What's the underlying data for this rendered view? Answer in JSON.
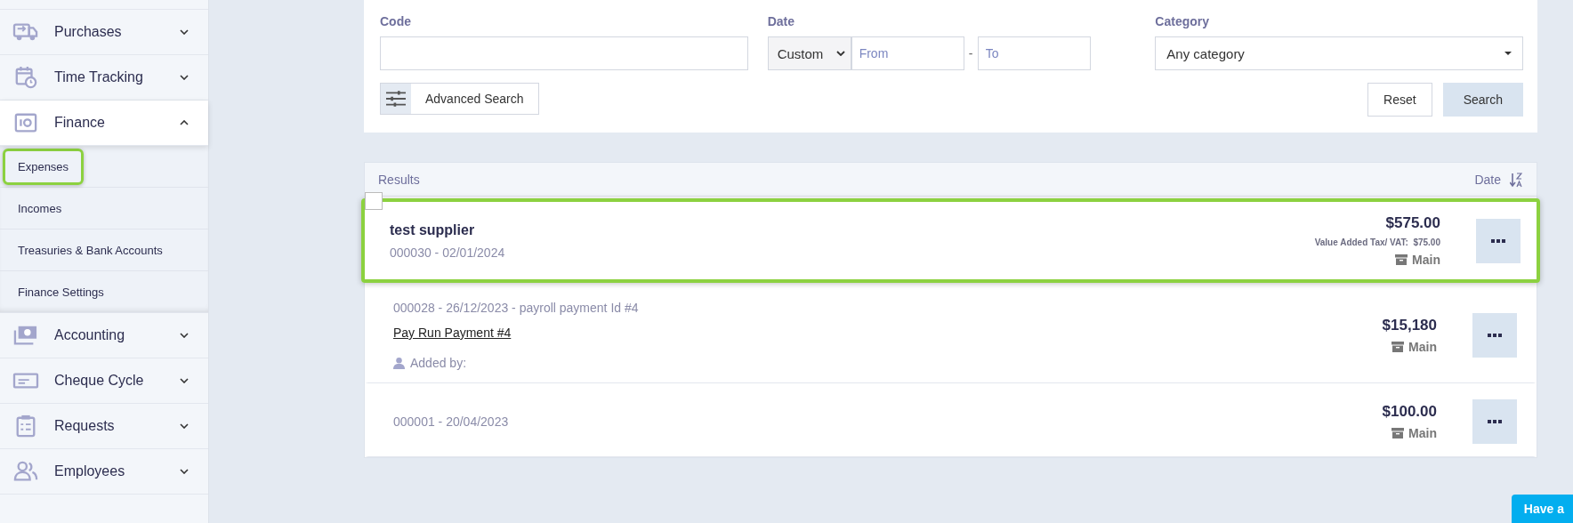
{
  "sidebar": {
    "items": [
      {
        "label": "Purchases",
        "expanded": false
      },
      {
        "label": "Time Tracking",
        "expanded": false
      },
      {
        "label": "Finance",
        "expanded": true,
        "children": [
          {
            "label": "Expenses",
            "highlighted": true
          },
          {
            "label": "Incomes",
            "highlighted": false
          },
          {
            "label": "Treasuries & Bank Accounts",
            "highlighted": false
          },
          {
            "label": "Finance Settings",
            "highlighted": false
          }
        ]
      },
      {
        "label": "Accounting",
        "expanded": false
      },
      {
        "label": "Cheque Cycle",
        "expanded": false
      },
      {
        "label": "Requests",
        "expanded": false
      },
      {
        "label": "Employees",
        "expanded": false
      }
    ]
  },
  "search": {
    "code_label": "Code",
    "date_label": "Date",
    "date_mode": "Custom",
    "from_placeholder": "From",
    "separator": "-",
    "to_placeholder": "To",
    "category_label": "Category",
    "category_value": "Any category",
    "advanced_button": "Advanced Search",
    "reset_button": "Reset",
    "search_button": "Search"
  },
  "results": {
    "title": "Results",
    "sort_label": "Date",
    "rows": [
      {
        "title": "test supplier",
        "meta": "000030 - 02/01/2024",
        "amount": "$575.00",
        "tax": "Value Added Tax/ VAT:  $75.00",
        "branch": "Main",
        "highlighted": true,
        "checkbox": {
          "checked": false
        }
      },
      {
        "meta": "000028 - 26/12/2023 - payroll payment Id #4",
        "link": "Pay Run Payment #4",
        "added_by": "Added by:",
        "amount": "$15,180",
        "branch": "Main",
        "highlighted": false
      },
      {
        "meta": "000001 - 20/04/2023",
        "amount": "$100.00",
        "branch": "Main",
        "highlighted": false
      }
    ]
  },
  "help_button": "Have a"
}
